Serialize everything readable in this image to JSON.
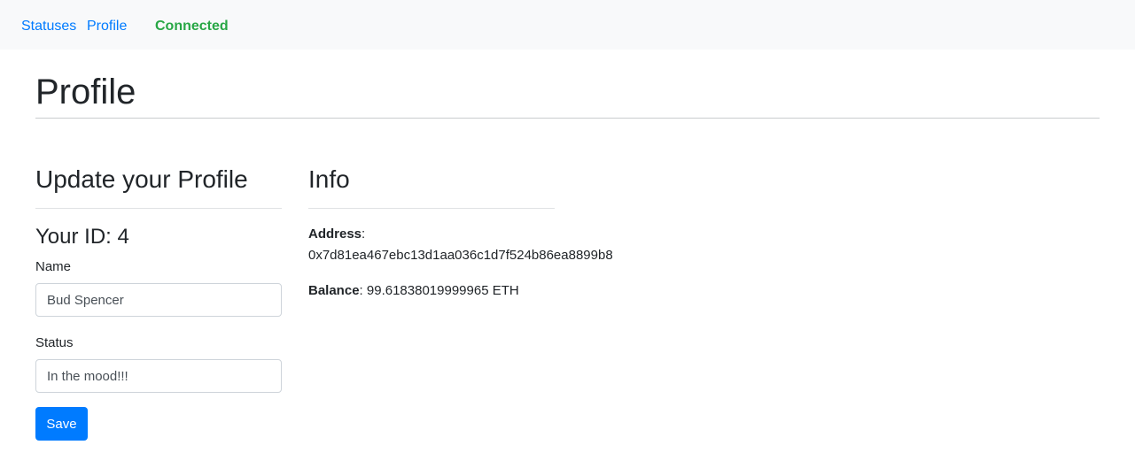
{
  "nav": {
    "statuses_label": "Statuses",
    "profile_label": "Profile",
    "connection_status": "Connected"
  },
  "page": {
    "title": "Profile"
  },
  "update_section": {
    "title": "Update your Profile",
    "your_id": "Your ID: 4",
    "name_label": "Name",
    "name_value": "Bud Spencer",
    "status_label": "Status",
    "status_value": "In the mood!!!",
    "save_label": "Save"
  },
  "info_section": {
    "title": "Info",
    "address_label": "Address",
    "address_value": "0x7d81ea467ebc13d1aa036c1d7f524b86ea8899b8",
    "balance_label": "Balance",
    "balance_value": "99.61838019999965 ETH",
    "separator": ":"
  },
  "colors": {
    "link": "#007bff",
    "connected": "#28a745",
    "primary_button": "#007bff",
    "navbar_bg": "#f8f9fa"
  }
}
